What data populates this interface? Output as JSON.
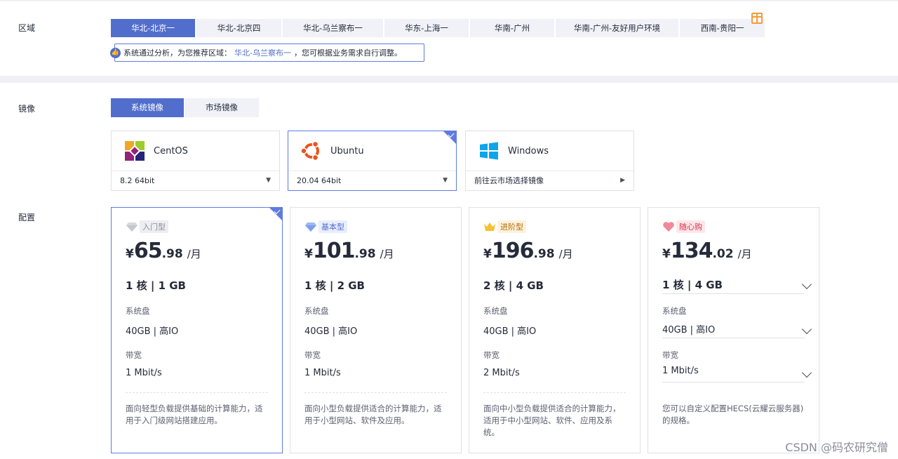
{
  "region": {
    "label": "区域",
    "tabs": [
      "华北-北京一",
      "华北-北京四",
      "华北-乌兰察布一",
      "华东-上海一",
      "华南-广州",
      "华南-广州-友好用户环境",
      "西南-贵阳一"
    ],
    "active_index": 0,
    "hint_prefix": "系统通过分析，为您推荐区域：",
    "hint_link": "华北-乌兰察布一",
    "hint_suffix": "，您可根据业务需求自行调整。"
  },
  "image": {
    "label": "镜像",
    "tabs": [
      "系统镜像",
      "市场镜像"
    ],
    "active_index": 0,
    "os": [
      {
        "name": "CentOS",
        "version": "8.2 64bit",
        "icon": "centos-logo-icon"
      },
      {
        "name": "Ubuntu",
        "version": "20.04 64bit",
        "icon": "ubuntu-logo-icon",
        "selected": true
      },
      {
        "name": "Windows",
        "version": "前往云市场选择镜像",
        "icon": "windows-logo-icon"
      }
    ]
  },
  "config": {
    "label": "配置",
    "cards": [
      {
        "badge": "入门型",
        "currency": "¥",
        "price_int": "65",
        "price_dec": ".98",
        "unit": "/月",
        "spec": "1 核  |  1 GB",
        "disk_label": "系统盘",
        "disk": "40GB | 高IO",
        "bw_label": "带宽",
        "bw": "1 Mbit/s",
        "desc": "面向轻型负载提供基础的计算能力，适用于入门级网站搭建应用。"
      },
      {
        "badge": "基本型",
        "currency": "¥",
        "price_int": "101",
        "price_dec": ".98",
        "unit": "/月",
        "spec": "1 核  |  2 GB",
        "disk_label": "系统盘",
        "disk": "40GB | 高IO",
        "bw_label": "带宽",
        "bw": "1 Mbit/s",
        "desc": "面向小型负载提供适合的计算能力，适用于小型网站、软件及应用。"
      },
      {
        "badge": "进阶型",
        "currency": "¥",
        "price_int": "196",
        "price_dec": ".98",
        "unit": "/月",
        "spec": "2 核  |  4 GB",
        "disk_label": "系统盘",
        "disk": "40GB | 高IO",
        "bw_label": "带宽",
        "bw": "2 Mbit/s",
        "desc": "面向中小型负载提供适合的计算能力，适用于中小型网站、软件、应用及系统。"
      },
      {
        "badge": "随心购",
        "currency": "¥",
        "price_int": "134",
        "price_dec": ".02",
        "unit": "/月",
        "spec": "1 核  |  4 GB",
        "disk_label": "系统盘",
        "disk": "40GB | 高IO",
        "bw_label": "带宽",
        "bw": "1 Mbit/s",
        "desc": "您可以自定义配置HECS(云耀云服务器)的规格。"
      }
    ]
  },
  "watermark": "CSDN @码农研究僧",
  "colors": {
    "accent": "#526ecc",
    "border": "#dfe1e6",
    "band": "#eef0f4"
  }
}
